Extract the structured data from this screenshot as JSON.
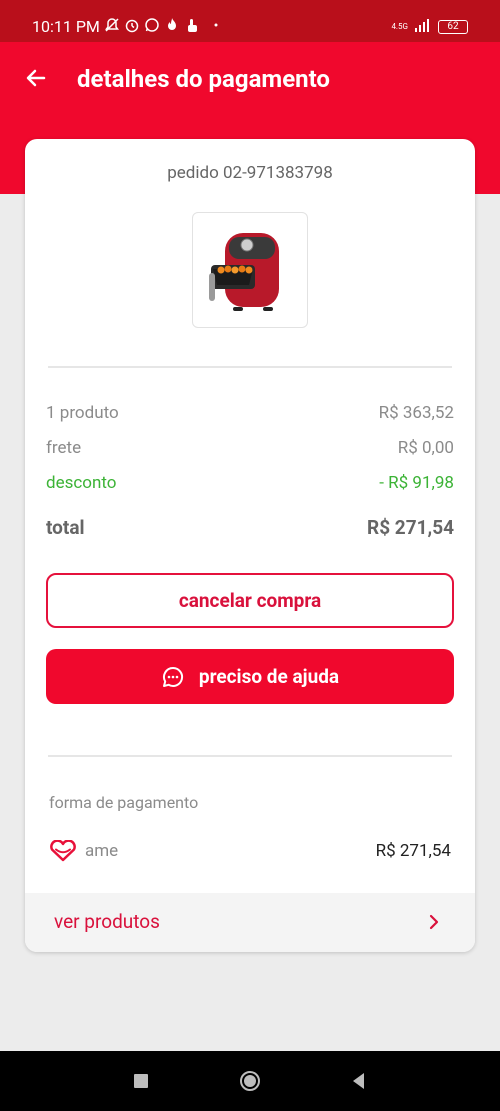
{
  "status_bar": {
    "time": "10:11 PM",
    "network": "4.5G",
    "battery": "62"
  },
  "header": {
    "title": "detalhes do pagamento"
  },
  "order": {
    "id_label": "pedido 02-971383798"
  },
  "summary": {
    "products_label": "1 produto",
    "products_value": "R$ 363,52",
    "shipping_label": "frete",
    "shipping_value": "R$ 0,00",
    "discount_label": "desconto",
    "discount_value": "- R$ 91,98",
    "total_label": "total",
    "total_value": "R$ 271,54"
  },
  "actions": {
    "cancel_label": "cancelar compra",
    "help_label": "preciso de ajuda"
  },
  "payment": {
    "section_label": "forma de pagamento",
    "method": "ame",
    "amount": "R$ 271,54"
  },
  "footer": {
    "link_label": "ver produtos"
  },
  "colors": {
    "brand": "#f0082d",
    "status_bar": "#b90f1b",
    "discount": "#3cb336"
  }
}
